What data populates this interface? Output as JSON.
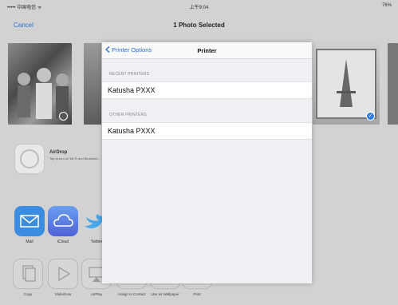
{
  "status_bar": {
    "carrier": "••••• 中国电信 ᯤ",
    "time": "上午9:04",
    "battery": "76%"
  },
  "topbar": {
    "cancel_label": "Cancel",
    "title": "1 Photo Selected"
  },
  "airdrop": {
    "title": "AirDrop",
    "subtitle": "Tap to turn on Wi-Fi and Bluetooth..."
  },
  "apps": [
    {
      "label": "Mail",
      "icon": "mail-icon",
      "color": "#3a8de0"
    },
    {
      "label": "iCloud",
      "icon": "icloud-icon",
      "color": "#5b7fe0"
    },
    {
      "label": "Twitter",
      "icon": "twitter-icon",
      "color": "#4aa8e8"
    }
  ],
  "actions": [
    {
      "label": "Copy",
      "icon": "copy-icon"
    },
    {
      "label": "Slideshow",
      "icon": "slideshow-icon"
    },
    {
      "label": "AirPlay",
      "icon": "airplay-icon"
    },
    {
      "label": "Assign to Contact",
      "icon": "contact-icon"
    },
    {
      "label": "Use as Wallpaper",
      "icon": "wallpaper-icon"
    },
    {
      "label": "Print",
      "icon": "print-icon"
    }
  ],
  "printer_modal": {
    "back_label": "Printer Options",
    "title": "Printer",
    "recent_header": "RECENT PRINTERS",
    "recent_printers": [
      "Katusha PXXX"
    ],
    "other_header": "OTHER PRINTERS",
    "other_printers": [
      "Katusha PXXX"
    ]
  },
  "colors": {
    "accent": "#2a6fd0",
    "checkmark": "#2a7ce0"
  }
}
